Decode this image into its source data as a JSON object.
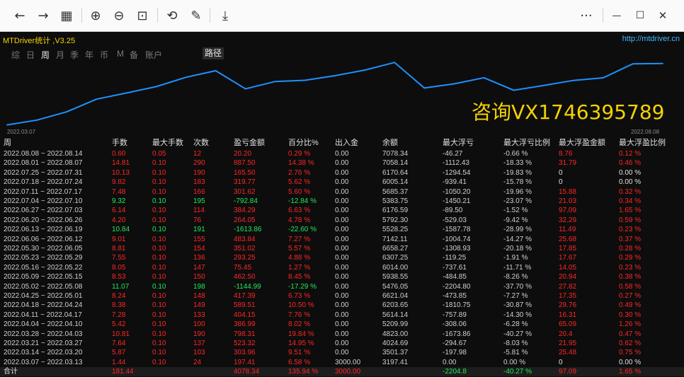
{
  "browser": {
    "back_icon": "←",
    "forward_icon": "→",
    "grid_icon": "▦",
    "zoom_in_icon": "⊕",
    "zoom_out_icon": "⊖",
    "fit_icon": "⊡",
    "rotate_icon": "⟲",
    "edit_icon": "✎",
    "save_icon": "⤓",
    "more_icon": "···",
    "minimize_icon": "—",
    "maximize_icon": "☐",
    "close_icon": "✕"
  },
  "app": {
    "title": "MTDriver统计 ,V3.25",
    "url": "http://mtdriver.cn",
    "watermark": "咨询VX1746395789",
    "accent_yellow": "#f5d300",
    "positive_color": "#21e85b",
    "negative_color": "#ff2626"
  },
  "nav": {
    "items": [
      "综",
      "日",
      "周",
      "月",
      "季",
      "年",
      "币",
      "M",
      "备",
      "账户"
    ],
    "active": "周",
    "route_label": "路径"
  },
  "chart_data": {
    "type": "line",
    "x_start_label": "2022.03.07",
    "x_end_label": "2022.08.08",
    "x": [
      "2022.03.07",
      "2022.03.14",
      "2022.03.21",
      "2022.03.28",
      "2022.04.04",
      "2022.04.11",
      "2022.04.18",
      "2022.04.25",
      "2022.05.02",
      "2022.05.09",
      "2022.05.16",
      "2022.05.23",
      "2022.05.30",
      "2022.06.06",
      "2022.06.13",
      "2022.06.20",
      "2022.06.27",
      "2022.07.04",
      "2022.07.11",
      "2022.07.18",
      "2022.07.25",
      "2022.08.01",
      "2022.08.08"
    ],
    "values": [
      3197.41,
      3501.37,
      4024.69,
      4823.0,
      5209.99,
      5614.14,
      6203.65,
      6621.04,
      5476.05,
      5938.55,
      6014.0,
      6307.25,
      6658.27,
      7142.11,
      5528.25,
      5792.3,
      6176.59,
      5383.75,
      5685.37,
      6005.14,
      6170.64,
      7058.14,
      7078.34
    ],
    "ylim": [
      3000,
      7200
    ],
    "line_color": "#1e90ff",
    "grid": false
  },
  "table": {
    "headers": [
      "周",
      "手数",
      "最大手数",
      "次数",
      "盈亏金额",
      "百分比%",
      "出入金",
      "余额",
      "最大浮亏",
      "最大浮亏比例",
      "最大浮盈金额",
      "最大浮盈比例"
    ],
    "rows": [
      [
        "2022.08.08 ~ 2022.08.14",
        "0.60",
        "0.05",
        "12",
        "20.20",
        "0.29 %",
        "0.00",
        "7078.34",
        "-46.27",
        "-0.66 %",
        "8.76",
        "0.12 %"
      ],
      [
        "2022.08.01 ~ 2022.08.07",
        "14.81",
        "0.10",
        "290",
        "887.50",
        "14.38 %",
        "0.00",
        "7058.14",
        "-1112.43",
        "-18.33 %",
        "31.79",
        "0.46 %"
      ],
      [
        "2022.07.25 ~ 2022.07.31",
        "10.13",
        "0.10",
        "190",
        "165.50",
        "2.76 %",
        "0.00",
        "6170.64",
        "-1294.54",
        "-19.83 %",
        "0",
        "0.00 %"
      ],
      [
        "2022.07.18 ~ 2022.07.24",
        "9.82",
        "0.10",
        "183",
        "319.77",
        "5.62 %",
        "0.00",
        "6005.14",
        "-939.41",
        "-15.78 %",
        "0",
        "0.00 %"
      ],
      [
        "2022.07.11 ~ 2022.07.17",
        "7.48",
        "0.10",
        "166",
        "301.62",
        "5.60 %",
        "0.00",
        "5685.37",
        "-1050.20",
        "-19.96 %",
        "15.88",
        "0.32 %"
      ],
      [
        "2022.07.04 ~ 2022.07.10",
        "9.32",
        "0.10",
        "195",
        "-792.84",
        "-12.84 %",
        "0.00",
        "5383.75",
        "-1450.21",
        "-23.07 %",
        "21.03",
        "0.34 %"
      ],
      [
        "2022.06.27 ~ 2022.07.03",
        "6.14",
        "0.10",
        "114",
        "384.29",
        "6.63 %",
        "0.00",
        "6176.59",
        "-89.50",
        "-1.52 %",
        "97.09",
        "1.65 %"
      ],
      [
        "2022.06.20 ~ 2022.06.26",
        "4.20",
        "0.10",
        "76",
        "264.05",
        "4.78 %",
        "0.00",
        "5792.30",
        "-529.03",
        "-9.42 %",
        "32.29",
        "0.59 %"
      ],
      [
        "2022.06.13 ~ 2022.06.19",
        "10.84",
        "0.10",
        "191",
        "-1613.86",
        "-22.60 %",
        "0.00",
        "5528.25",
        "-1587.78",
        "-28.99 %",
        "11.49",
        "0.23 %"
      ],
      [
        "2022.06.06 ~ 2022.06.12",
        "9.01",
        "0.10",
        "155",
        "483.84",
        "7.27 %",
        "0.00",
        "7142.11",
        "-1004.74",
        "-14.27 %",
        "25.68",
        "0.37 %"
      ],
      [
        "2022.05.30 ~ 2022.06.05",
        "8.81",
        "0.10",
        "154",
        "351.02",
        "5.57 %",
        "0.00",
        "6658.27",
        "-1308.93",
        "-20.18 %",
        "17.85",
        "0.28 %"
      ],
      [
        "2022.05.23 ~ 2022.05.29",
        "7.55",
        "0.10",
        "136",
        "293.25",
        "4.88 %",
        "0.00",
        "6307.25",
        "-119.25",
        "-1.91 %",
        "17.67",
        "0.29 %"
      ],
      [
        "2022.05.16 ~ 2022.05.22",
        "8.05",
        "0.10",
        "147",
        "75.45",
        "1.27 %",
        "0.00",
        "6014.00",
        "-737.61",
        "-11.71 %",
        "14.05",
        "0.23 %"
      ],
      [
        "2022.05.09 ~ 2022.05.15",
        "8.53",
        "0.10",
        "150",
        "462.50",
        "8.45 %",
        "0.00",
        "5938.55",
        "-484.85",
        "-8.26 %",
        "20.94",
        "0.38 %"
      ],
      [
        "2022.05.02 ~ 2022.05.08",
        "11.07",
        "0.10",
        "198",
        "-1144.99",
        "-17.29 %",
        "0.00",
        "5476.05",
        "-2204.80",
        "-37.70 %",
        "27.82",
        "0.58 %"
      ],
      [
        "2022.04.25 ~ 2022.05.01",
        "8.24",
        "0.10",
        "148",
        "417.39",
        "6.73 %",
        "0.00",
        "6621.04",
        "-473.85",
        "-7.27 %",
        "17.35",
        "0.27 %"
      ],
      [
        "2022.04.18 ~ 2022.04.24",
        "8.38",
        "0.10",
        "149",
        "589.51",
        "10.50 %",
        "0.00",
        "6203.65",
        "-1810.75",
        "-30.87 %",
        "29.76",
        "0.49 %"
      ],
      [
        "2022.04.11 ~ 2022.04.17",
        "7.28",
        "0.10",
        "133",
        "404.15",
        "7.76 %",
        "0.00",
        "5614.14",
        "-757.89",
        "-14.30 %",
        "16.31",
        "0.30 %"
      ],
      [
        "2022.04.04 ~ 2022.04.10",
        "5.42",
        "0.10",
        "100",
        "386.99",
        "8.02 %",
        "0.00",
        "5209.99",
        "-308.06",
        "-6.28 %",
        "65.09",
        "1.26 %"
      ],
      [
        "2022.03.28 ~ 2022.04.03",
        "10.81",
        "0.10",
        "190",
        "798.31",
        "19.84 %",
        "0.00",
        "4823.00",
        "-1673.86",
        "-40.27 %",
        "20.4",
        "0.47 %"
      ],
      [
        "2022.03.21 ~ 2022.03.27",
        "7.64",
        "0.10",
        "137",
        "523.32",
        "14.95 %",
        "0.00",
        "4024.69",
        "-294.67",
        "-8.03 %",
        "21.95",
        "0.62 %"
      ],
      [
        "2022.03.14 ~ 2022.03.20",
        "5.87",
        "0.10",
        "103",
        "303.96",
        "9.51 %",
        "0.00",
        "3501.37",
        "-197.98",
        "-5.81 %",
        "25.48",
        "0.75 %"
      ],
      [
        "2022.03.07 ~ 2022.03.13",
        "1.44",
        "0.10",
        "24",
        "197.41",
        "6.58 %",
        "3000.00",
        "3197.41",
        "0.00",
        "0.00 %",
        "0",
        "0.00 %"
      ]
    ],
    "total": [
      "合计",
      "181.44",
      "",
      "",
      "4078.34",
      "135.94 %",
      "3000.00",
      "",
      "-2204.8",
      "-40.27 %",
      "97.09",
      "1.65 %"
    ]
  }
}
